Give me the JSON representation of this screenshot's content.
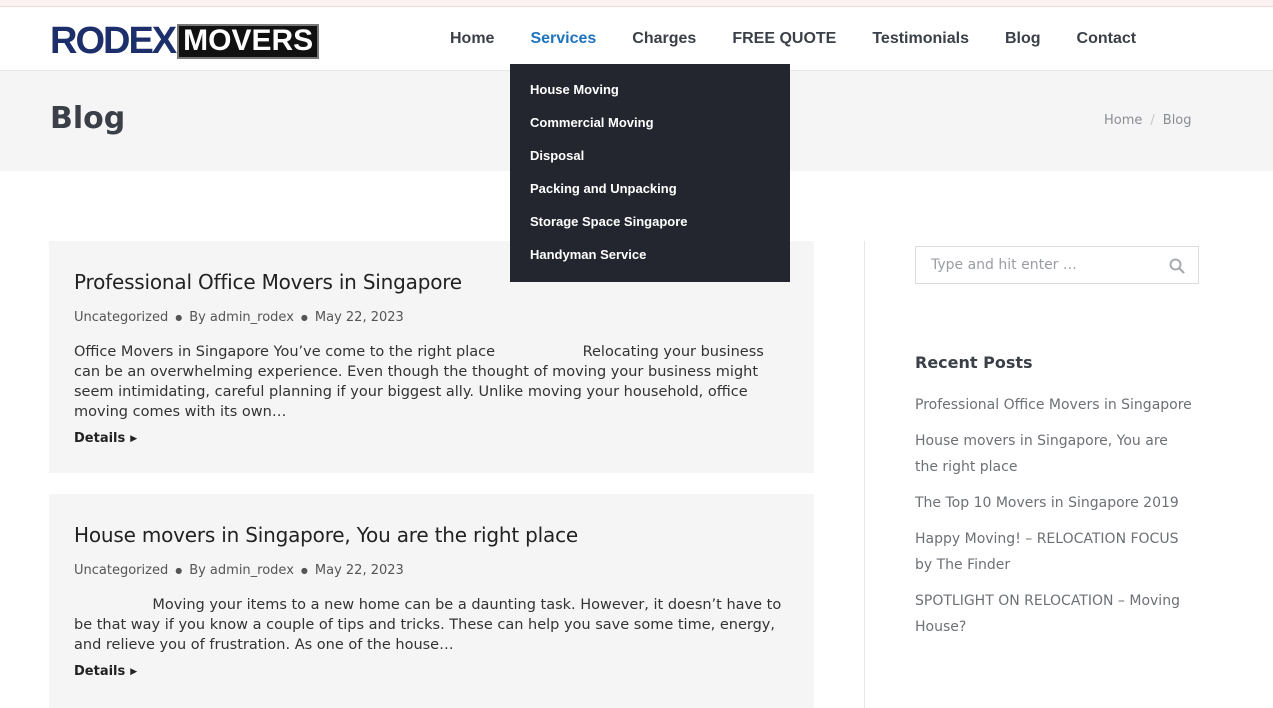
{
  "header": {
    "logo": {
      "part1": "RODEX",
      "part2": "MOVERS"
    },
    "nav": [
      "Home",
      "Services",
      "Charges",
      "FREE QUOTE",
      "Testimonials",
      "Blog",
      "Contact"
    ],
    "active_nav": "Services"
  },
  "services_menu": [
    "House Moving",
    "Commercial Moving",
    "Disposal",
    "Packing and Unpacking",
    "Storage Space Singapore",
    "Handyman Service"
  ],
  "page": {
    "title": "Blog",
    "breadcrumb": [
      "Home",
      "Blog"
    ],
    "breadcrumb_sep": "/"
  },
  "posts": [
    {
      "title": "Professional Office Movers in Singapore",
      "category": "Uncategorized",
      "author": "By admin_rodex",
      "date": "May 22, 2023",
      "excerpt": "Office Movers in Singapore You’ve come to the right place                   Relocating your business can be an overwhelming experience. Even though the thought of moving your business might seem intimidating, careful planning if your biggest ally. Unlike moving your household, office moving comes with its own…",
      "details_label": "Details"
    },
    {
      "title": "House movers in Singapore, You are the right place",
      "category": "Uncategorized",
      "author": "By admin_rodex",
      "date": "May 22, 2023",
      "excerpt": "                 Moving your items to a new home can be a daunting task. However, it doesn’t have to be that way if you know a couple of tips and tricks. These can help you save some time, energy, and relieve you of frustration. As one of the house…",
      "details_label": "Details"
    }
  ],
  "sidebar": {
    "search_placeholder": "Type and hit enter …",
    "recent_title": "Recent Posts",
    "recent_posts": [
      "Professional Office Movers in Singapore",
      "House movers in Singapore, You are the right place",
      "The Top 10 Movers in Singapore 2019",
      "Happy Moving! – RELOCATION FOCUS by The Finder",
      "SPOTLIGHT ON RELOCATION – Moving House?"
    ]
  },
  "colors": {
    "accent": "#1e73be",
    "dropdown_bg": "#23262e",
    "logo_blue": "#1c2f6b"
  }
}
